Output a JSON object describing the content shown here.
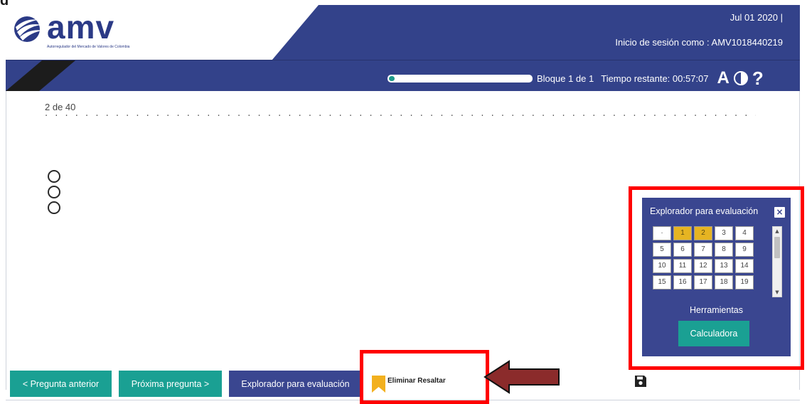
{
  "header": {
    "logo_text": "amv",
    "logo_subtitle": "Autorregulador del Mercado de Valores de Colombia",
    "date": "Jul 01 2020 |",
    "login": "Inicio de sesión como : AMV1018440219",
    "block": "Bloque 1 de 1",
    "time_remaining": "Tiempo restante: 00:57:07",
    "font_icon": "A",
    "help_icon": "?",
    "progress_fraction": 0.025
  },
  "question": {
    "number": "2  de 40",
    "option_count": 3
  },
  "explorer": {
    "title": "Explorador para evaluación",
    "close": "×",
    "cells": [
      {
        "label": "·",
        "active": false
      },
      {
        "label": "1",
        "active": true
      },
      {
        "label": "2",
        "active": true
      },
      {
        "label": "3",
        "active": false
      },
      {
        "label": "4",
        "active": false
      },
      {
        "label": "5",
        "active": false
      },
      {
        "label": "6",
        "active": false
      },
      {
        "label": "7",
        "active": false
      },
      {
        "label": "8",
        "active": false
      },
      {
        "label": "9",
        "active": false
      },
      {
        "label": "10",
        "active": false
      },
      {
        "label": "11",
        "active": false
      },
      {
        "label": "12",
        "active": false
      },
      {
        "label": "13",
        "active": false
      },
      {
        "label": "14",
        "active": false
      },
      {
        "label": "15",
        "active": false
      },
      {
        "label": "16",
        "active": false
      },
      {
        "label": "17",
        "active": false
      },
      {
        "label": "18",
        "active": false
      },
      {
        "label": "19",
        "active": false
      }
    ],
    "tools_label": "Herramientas",
    "calculator": "Calculadora"
  },
  "footer": {
    "prev": "< Pregunta anterior",
    "next": "Próxima pregunta >",
    "explorer": "Explorador para evaluación",
    "remove_highlight": "Eliminar Resaltar"
  },
  "icons": {
    "contrast": "contrast-icon",
    "save": "save-icon",
    "bookmark": "bookmark-icon"
  },
  "colors": {
    "header": "#33428a",
    "teal": "#1aa093",
    "navy": "#3a4690",
    "active_cell": "#e6b422",
    "annotation_red": "#ff0000",
    "arrow": "#8b2b2b"
  }
}
